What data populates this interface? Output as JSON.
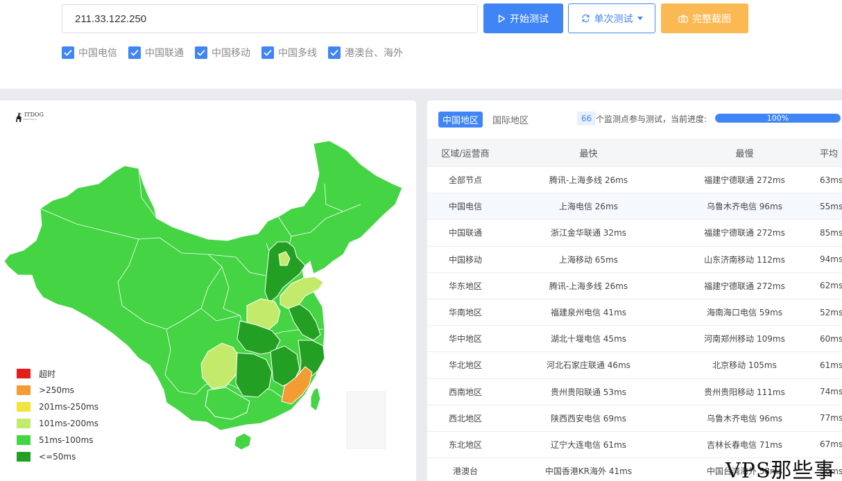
{
  "search": {
    "ip_value": "211.33.122.250"
  },
  "buttons": {
    "start": "开始测试",
    "single": "单次测试",
    "screenshot": "完整截图"
  },
  "filters": [
    {
      "label": "中国电信",
      "checked": true
    },
    {
      "label": "中国联通",
      "checked": true
    },
    {
      "label": "中国移动",
      "checked": true
    },
    {
      "label": "中国多线",
      "checked": true
    },
    {
      "label": "港澳台、海外",
      "checked": true
    }
  ],
  "logo": {
    "text": "ITDOG",
    "sub": "www.itdog.cn"
  },
  "legend": [
    {
      "label": "超时",
      "color": "#e41c1c"
    },
    {
      "label": ">250ms",
      "color": "#f59b33"
    },
    {
      "label": "201ms-250ms",
      "color": "#f3e33f"
    },
    {
      "label": "101ms-200ms",
      "color": "#c4ea6c"
    },
    {
      "label": "51ms-100ms",
      "color": "#45d444"
    },
    {
      "label": "<=50ms",
      "color": "#23a023"
    }
  ],
  "tabs": {
    "china": "中国地区",
    "intl": "国际地区"
  },
  "status": {
    "count": "66",
    "text": "个监测点参与测试，当前进度:",
    "progress_label": "100%",
    "progress": 1.0
  },
  "table": {
    "headers": [
      "区域/运营商",
      "最快",
      "最慢",
      "平均"
    ],
    "rows": [
      [
        "全部节点",
        "腾讯-上海多线 26ms",
        "福建宁德联通 272ms",
        "63ms"
      ],
      [
        "中国电信",
        "上海电信 26ms",
        "乌鲁木齐电信 96ms",
        "55ms"
      ],
      [
        "中国联通",
        "浙江金华联通 32ms",
        "福建宁德联通 272ms",
        "85ms"
      ],
      [
        "中国移动",
        "上海移动 65ms",
        "山东济南移动 112ms",
        "94ms"
      ],
      [
        "华东地区",
        "腾讯-上海多线 26ms",
        "福建宁德联通 272ms",
        "62ms"
      ],
      [
        "华南地区",
        "福建泉州电信 41ms",
        "海南海口电信 59ms",
        "52ms"
      ],
      [
        "华中地区",
        "湖北十堰电信 45ms",
        "河南郑州移动 109ms",
        "60ms"
      ],
      [
        "华北地区",
        "河北石家庄联通 46ms",
        "北京移动 105ms",
        "61ms"
      ],
      [
        "西南地区",
        "贵州贵阳联通 53ms",
        "贵州贵阳移动 111ms",
        "74ms"
      ],
      [
        "西北地区",
        "陕西西安电信 69ms",
        "乌鲁木齐电信 96ms",
        "77ms"
      ],
      [
        "东北地区",
        "辽宁大连电信 61ms",
        "吉林长春电信 71ms",
        "67ms"
      ],
      [
        "港澳台",
        "中国香港KR海外 41ms",
        "中国台湾海外 58ms",
        "50ms"
      ]
    ]
  },
  "watermark": "VPS那些事"
}
